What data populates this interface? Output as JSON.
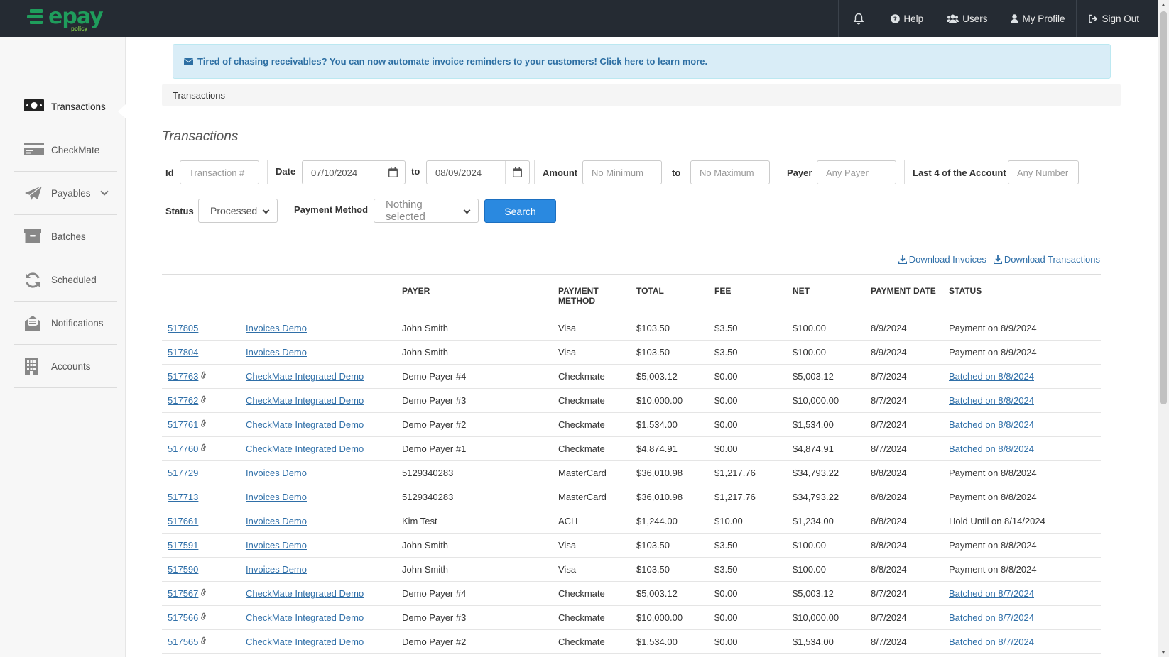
{
  "brand": {
    "name": "epay",
    "sub": "policy"
  },
  "topnav": {
    "help": "Help",
    "users": "Users",
    "profile": "My Profile",
    "signout": "Sign Out"
  },
  "sidebar": {
    "items": [
      {
        "label": "Transactions",
        "icon": "money-icon"
      },
      {
        "label": "CheckMate",
        "icon": "check-card-icon"
      },
      {
        "label": "Payables",
        "icon": "paper-plane-icon"
      },
      {
        "label": "Batches",
        "icon": "archive-box-icon"
      },
      {
        "label": "Scheduled",
        "icon": "refresh-icon"
      },
      {
        "label": "Notifications",
        "icon": "envelope-open-icon"
      },
      {
        "label": "Accounts",
        "icon": "building-icon"
      }
    ]
  },
  "alert": {
    "text": "Tired of chasing receivables? You can now automate invoice reminders to your customers! Click here to learn more."
  },
  "breadcrumb": "Transactions",
  "title": "Transactions",
  "filters": {
    "id_label": "Id",
    "id_placeholder": "Transaction #",
    "date_label": "Date",
    "date_from": "07/10/2024",
    "to_label": "to",
    "date_to": "08/09/2024",
    "amount_label": "Amount",
    "amount_min_placeholder": "No Minimum",
    "amount_max_placeholder": "No Maximum",
    "payer_label": "Payer",
    "payer_placeholder": "Any Payer",
    "last4_label": "Last 4 of the Account",
    "last4_placeholder": "Any Number",
    "status_label": "Status",
    "status_value": "Processed",
    "method_label": "Payment Method",
    "method_value": "Nothing selected",
    "search_label": "Search"
  },
  "downloads": {
    "invoices": "Download Invoices",
    "transactions": "Download Transactions"
  },
  "table": {
    "headers": {
      "payer": "PAYER",
      "method_1": "PAYMENT",
      "method_2": "METHOD",
      "total": "TOTAL",
      "fee": "FEE",
      "net": "NET",
      "date": "PAYMENT DATE",
      "status": "STATUS"
    },
    "rows": [
      {
        "id": "517805",
        "attach": false,
        "account": "Invoices Demo",
        "payer": "John Smith",
        "method": "Visa",
        "total": "$103.50",
        "fee": "$3.50",
        "net": "$100.00",
        "date": "8/9/2024",
        "status": "Payment on 8/9/2024",
        "status_link": false
      },
      {
        "id": "517804",
        "attach": false,
        "account": "Invoices Demo",
        "payer": "John Smith",
        "method": "Visa",
        "total": "$103.50",
        "fee": "$3.50",
        "net": "$100.00",
        "date": "8/9/2024",
        "status": "Payment on 8/9/2024",
        "status_link": false
      },
      {
        "id": "517763",
        "attach": true,
        "account": "CheckMate Integrated Demo",
        "payer": "Demo Payer #4",
        "method": "Checkmate",
        "total": "$5,003.12",
        "fee": "$0.00",
        "net": "$5,003.12",
        "date": "8/7/2024",
        "status": "Batched on 8/8/2024",
        "status_link": true
      },
      {
        "id": "517762",
        "attach": true,
        "account": "CheckMate Integrated Demo",
        "payer": "Demo Payer #3",
        "method": "Checkmate",
        "total": "$10,000.00",
        "fee": "$0.00",
        "net": "$10,000.00",
        "date": "8/7/2024",
        "status": "Batched on 8/8/2024",
        "status_link": true
      },
      {
        "id": "517761",
        "attach": true,
        "account": "CheckMate Integrated Demo",
        "payer": "Demo Payer #2",
        "method": "Checkmate",
        "total": "$1,534.00",
        "fee": "$0.00",
        "net": "$1,534.00",
        "date": "8/7/2024",
        "status": "Batched on 8/8/2024",
        "status_link": true
      },
      {
        "id": "517760",
        "attach": true,
        "account": "CheckMate Integrated Demo",
        "payer": "Demo Payer #1",
        "method": "Checkmate",
        "total": "$4,874.91",
        "fee": "$0.00",
        "net": "$4,874.91",
        "date": "8/7/2024",
        "status": "Batched on 8/8/2024",
        "status_link": true
      },
      {
        "id": "517729",
        "attach": false,
        "account": "Invoices Demo",
        "payer": "5129340283",
        "method": "MasterCard",
        "total": "$36,010.98",
        "fee": "$1,217.76",
        "net": "$34,793.22",
        "date": "8/8/2024",
        "status": "Payment on 8/8/2024",
        "status_link": false
      },
      {
        "id": "517713",
        "attach": false,
        "account": "Invoices Demo",
        "payer": "5129340283",
        "method": "MasterCard",
        "total": "$36,010.98",
        "fee": "$1,217.76",
        "net": "$34,793.22",
        "date": "8/8/2024",
        "status": "Payment on 8/8/2024",
        "status_link": false
      },
      {
        "id": "517661",
        "attach": false,
        "account": "Invoices Demo",
        "payer": "Kim Test",
        "method": "ACH",
        "total": "$1,244.00",
        "fee": "$10.00",
        "net": "$1,234.00",
        "date": "8/8/2024",
        "status": "Hold Until on 8/14/2024",
        "status_link": false
      },
      {
        "id": "517591",
        "attach": false,
        "account": "Invoices Demo",
        "payer": "John Smith",
        "method": "Visa",
        "total": "$103.50",
        "fee": "$3.50",
        "net": "$100.00",
        "date": "8/8/2024",
        "status": "Payment on 8/8/2024",
        "status_link": false
      },
      {
        "id": "517590",
        "attach": false,
        "account": "Invoices Demo",
        "payer": "John Smith",
        "method": "Visa",
        "total": "$103.50",
        "fee": "$3.50",
        "net": "$100.00",
        "date": "8/8/2024",
        "status": "Payment on 8/8/2024",
        "status_link": false
      },
      {
        "id": "517567",
        "attach": true,
        "account": "CheckMate Integrated Demo",
        "payer": "Demo Payer #4",
        "method": "Checkmate",
        "total": "$5,003.12",
        "fee": "$0.00",
        "net": "$5,003.12",
        "date": "8/7/2024",
        "status": "Batched on 8/7/2024",
        "status_link": true
      },
      {
        "id": "517566",
        "attach": true,
        "account": "CheckMate Integrated Demo",
        "payer": "Demo Payer #3",
        "method": "Checkmate",
        "total": "$10,000.00",
        "fee": "$0.00",
        "net": "$10,000.00",
        "date": "8/7/2024",
        "status": "Batched on 8/7/2024",
        "status_link": true
      },
      {
        "id": "517565",
        "attach": true,
        "account": "CheckMate Integrated Demo",
        "payer": "Demo Payer #2",
        "method": "Checkmate",
        "total": "$1,534.00",
        "fee": "$0.00",
        "net": "$1,534.00",
        "date": "8/7/2024",
        "status": "Batched on 8/7/2024",
        "status_link": true
      }
    ]
  },
  "colors": {
    "topbar": "#252b33",
    "brand_green": "#1f9d5c",
    "link": "#2f6fa8",
    "primary_button": "#2a89e0",
    "alert_bg": "#d9edf7"
  }
}
